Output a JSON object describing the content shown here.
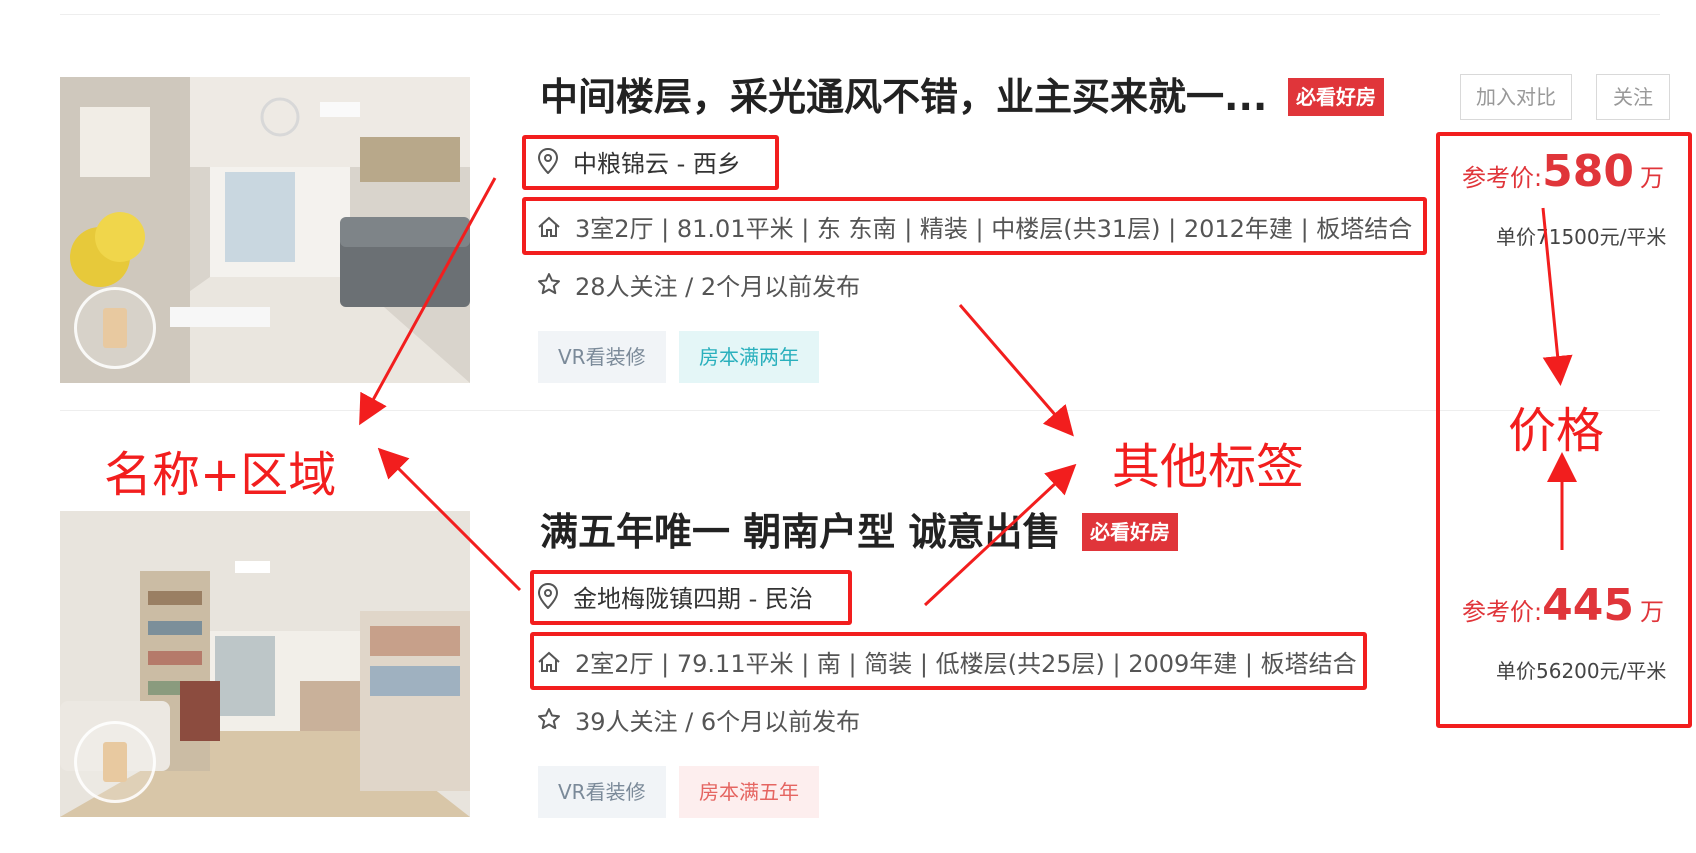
{
  "listings": [
    {
      "title": "中间楼层，采光通风不错，业主买来就一...",
      "badge": "必看好房",
      "location": "中粮锦云 - 西乡",
      "details": "3室2厅 | 81.01平米 | 东 东南 | 精装 | 中楼层(共31层) | 2012年建 | 板塔结合",
      "followers": "28人关注 / 2个月以前发布",
      "tags": [
        "VR看装修",
        "房本满两年"
      ],
      "price_label": "参考价:",
      "price": "580",
      "price_unit": "万",
      "unit_price": "单价71500元/平米"
    },
    {
      "title": "满五年唯一 朝南户型 诚意出售",
      "badge": "必看好房",
      "location": "金地梅陇镇四期 - 民治",
      "details": "2室2厅 | 79.11平米 | 南 | 简装 | 低楼层(共25层) | 2009年建 | 板塔结合",
      "followers": "39人关注 / 6个月以前发布",
      "tags": [
        "VR看装修",
        "房本满五年"
      ],
      "price_label": "参考价:",
      "price": "445",
      "price_unit": "万",
      "unit_price": "单价56200元/平米"
    }
  ],
  "actions": {
    "compare": "加入对比",
    "follow": "关注"
  },
  "annotations": {
    "name_region": "名称+区域",
    "other_tags": "其他标签",
    "price": "价格"
  },
  "colors": {
    "accent": "#e0353a",
    "annotation": "#f21e1e"
  },
  "icons": [
    "location-pin-icon",
    "house-icon",
    "star-icon",
    "vr-play-icon"
  ]
}
